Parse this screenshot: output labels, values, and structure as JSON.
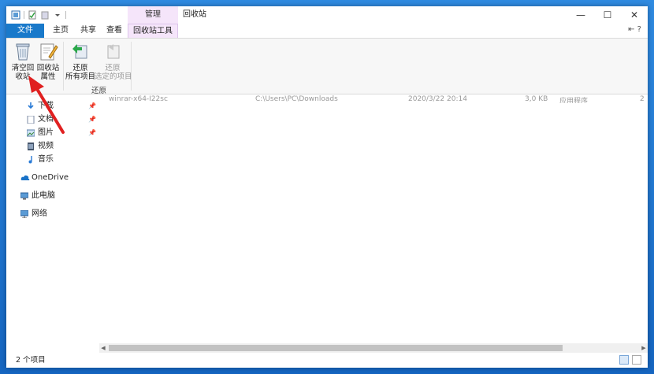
{
  "window": {
    "title": "回收站",
    "context_group": "管理",
    "controls": {
      "minimize": "—",
      "maximize": "☐",
      "close": "✕"
    }
  },
  "tabs": {
    "file": "文件",
    "home": "主页",
    "share": "共享",
    "view": "查看",
    "context_tools": "回收站工具",
    "right_controls": "⇤ ?"
  },
  "ribbon": {
    "empty_bin": "清空回\n收站",
    "bin_props": "回收站\n属性",
    "restore_all": "还原\n所有项目",
    "restore_selected": "还原\n选定的项目",
    "group_restore": "还原"
  },
  "nav": {
    "downloads": "下载",
    "docs": "文档",
    "pictures": "图片",
    "videos": "视频",
    "music": "音乐",
    "onedrive": "OneDrive",
    "this_pc": "此电脑",
    "network": "网络"
  },
  "content": {
    "ghost_name": "winrar-x64-I22sc",
    "ghost_path": "C:\\Users\\PC\\Downloads",
    "ghost_date": "2020/3/22 20:14",
    "ghost_size": "3,0 KB",
    "ghost_type": "应用程序",
    "ghost_extra": "2"
  },
  "status": {
    "items": "2 个项目"
  },
  "colors": {
    "accent": "#1979ca",
    "context": "#f5e5fa",
    "arrow": "#e02020"
  }
}
